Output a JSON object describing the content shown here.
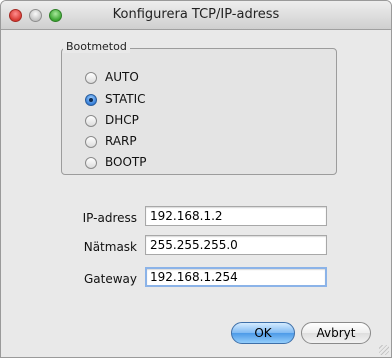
{
  "window": {
    "title": "Konfigurera TCP/IP-adress"
  },
  "bootmethod": {
    "legend": "Bootmetod",
    "options": [
      {
        "label": "AUTO",
        "selected": false
      },
      {
        "label": "STATIC",
        "selected": true
      },
      {
        "label": "DHCP",
        "selected": false
      },
      {
        "label": "RARP",
        "selected": false
      },
      {
        "label": "BOOTP",
        "selected": false
      }
    ]
  },
  "fields": {
    "ip": {
      "label": "IP-adress",
      "value": "192.168.1.2"
    },
    "netmask": {
      "label": "Nätmask",
      "value": "255.255.255.0"
    },
    "gateway": {
      "label": "Gateway",
      "value": "192.168.1.254"
    }
  },
  "buttons": {
    "ok": "OK",
    "cancel": "Avbryt"
  },
  "colors": {
    "accent": "#4d9ae8",
    "window_bg": "#e9e9e9"
  }
}
